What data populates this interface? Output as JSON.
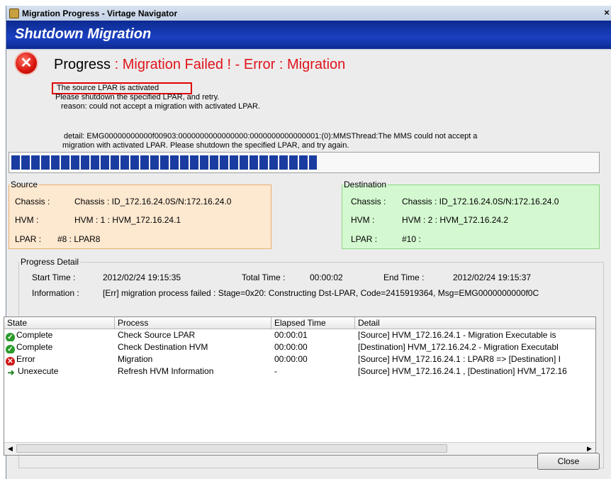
{
  "window": {
    "title": "Migration Progress - Virtage Navigator",
    "close_glyph": "×"
  },
  "banner": {
    "title": "Shutdown Migration"
  },
  "status": {
    "label": "Progress",
    "separator": ":",
    "value": "Migration Failed ! - Error : Migration",
    "icon": "error-icon",
    "color": "#e0141c"
  },
  "message": {
    "line1": "The source LPAR is activated",
    "line2": "Please shutdown the specified LPAR, and retry.",
    "line3": "reason: could not accept a migration with activated LPAR.",
    "line4": "detail:  EMG00000000000f00903:0000000000000000:0000000000000001:(0):MMSThread:The MMS could not accept a",
    "line5": "migration with activated LPAR. Please shutdown the specified LPAR, and try again."
  },
  "progress": {
    "fraction": 0.52
  },
  "source": {
    "legend": "Source",
    "chassis_label": "Chassis :",
    "chassis_value": "Chassis : ID_172.16.24.0S/N:172.16.24.0",
    "hvm_label": "HVM :",
    "hvm_value": "HVM : 1 : HVM_172.16.24.1",
    "lpar_label": "LPAR :",
    "lpar_value": "#8 : LPAR8"
  },
  "destination": {
    "legend": "Destination",
    "chassis_label": "Chassis :",
    "chassis_value": "Chassis : ID_172.16.24.0S/N:172.16.24.0",
    "hvm_label": "HVM :",
    "hvm_value": "HVM : 2 : HVM_172.16.24.2",
    "lpar_label": "LPAR :",
    "lpar_value": "#10 :"
  },
  "detail": {
    "legend": "Progress Detail",
    "start_label": "Start Time :",
    "start_value": "2012/02/24 19:15:35",
    "total_label": "Total Time :",
    "total_value": "00:00:02",
    "end_label": "End Time :",
    "end_value": "2012/02/24 19:15:37",
    "info_label": "Information :",
    "info_value": "[Err] migration process failed : Stage=0x20: Constructing Dst-LPAR, Code=2415919364, Msg=EMG0000000000f0C"
  },
  "table": {
    "columns": [
      "State",
      "Process",
      "Elapsed Time",
      "Detail"
    ],
    "rows": [
      {
        "icon": "check-icon",
        "state": "Complete",
        "process": "Check Source LPAR",
        "elapsed": "00:00:01",
        "detail": "[Source] HVM_172.16.24.1    - Migration Executable is"
      },
      {
        "icon": "check-icon",
        "state": "Complete",
        "process": "Check Destination HVM",
        "elapsed": "00:00:00",
        "detail": "[Destination] HVM_172.16.24.2    - Migration Executabl"
      },
      {
        "icon": "error-icon",
        "state": "Error",
        "process": "Migration",
        "elapsed": "00:00:00",
        "detail": "[Source] HVM_172.16.24.1    : LPAR8 => [Destination] I"
      },
      {
        "icon": "unexecute-icon",
        "state": "Unexecute",
        "process": "Refresh HVM Information",
        "elapsed": "-",
        "detail": "[Source] HVM_172.16.24.1    , [Destination] HVM_172.16"
      }
    ]
  },
  "buttons": {
    "close": "Close"
  }
}
